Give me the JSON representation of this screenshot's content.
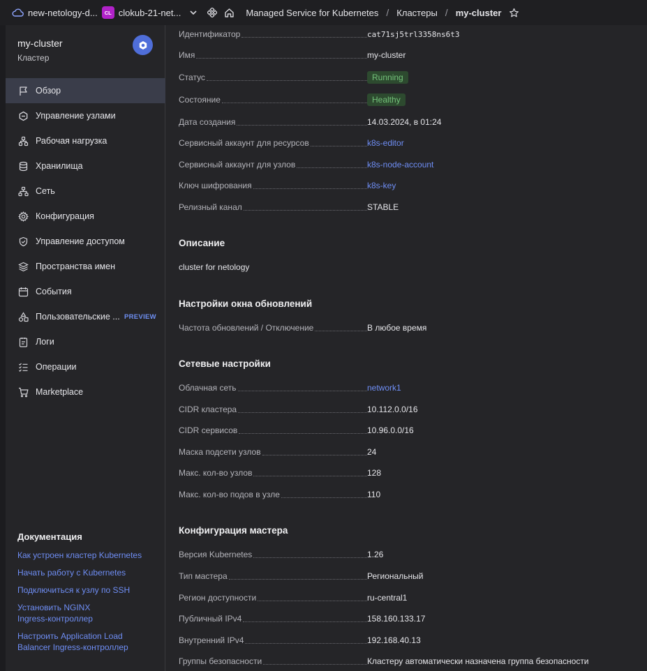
{
  "topbar": {
    "cloud_name": "new-netology-d...",
    "folder_badge": "CL",
    "folder_name": "clokub-21-net...",
    "breadcrumb": [
      "Managed Service for Kubernetes",
      "Кластеры",
      "my-cluster"
    ],
    "separator": "/"
  },
  "cluster": {
    "name": "my-cluster",
    "subtitle": "Кластер"
  },
  "sidebar": {
    "items": [
      {
        "label": "Обзор",
        "icon": "flag-icon",
        "active": true
      },
      {
        "label": "Управление узлами",
        "icon": "nodes-icon"
      },
      {
        "label": "Рабочая нагрузка",
        "icon": "workload-icon"
      },
      {
        "label": "Хранилища",
        "icon": "database-icon"
      },
      {
        "label": "Сеть",
        "icon": "network-icon"
      },
      {
        "label": "Конфигурация",
        "icon": "gear-icon"
      },
      {
        "label": "Управление доступом",
        "icon": "shield-icon"
      },
      {
        "label": "Пространства имен",
        "icon": "namespaces-icon"
      },
      {
        "label": "События",
        "icon": "calendar-icon"
      },
      {
        "label": "Пользовательские ...",
        "icon": "shapes-icon",
        "badge": "PREVIEW"
      },
      {
        "label": "Логи",
        "icon": "logs-icon"
      },
      {
        "label": "Операции",
        "icon": "operations-icon"
      },
      {
        "label": "Marketplace",
        "icon": "cart-icon"
      }
    ]
  },
  "docs": {
    "title": "Документация",
    "links": [
      "Как устроен кластер Kubernetes",
      "Начать работу с Kubernetes",
      "Подключиться к узлу по SSH",
      "Установить NGINX Ingress-контроллер",
      "Настроить Application Load Balancer Ingress-контроллер"
    ]
  },
  "overview": {
    "id_label": "Идентификатор",
    "id_value": "cat71sj5trl3358ns6t3",
    "name_label": "Имя",
    "name_value": "my-cluster",
    "status_label": "Статус",
    "status_value": "Running",
    "health_label": "Состояние",
    "health_value": "Healthy",
    "created_label": "Дата создания",
    "created_value": "14.03.2024, в 01:24",
    "sa_res_label": "Сервисный аккаунт для ресурсов",
    "sa_res_value": "k8s-editor",
    "sa_nodes_label": "Сервисный аккаунт для узлов",
    "sa_nodes_value": "k8s-node-account",
    "key_label": "Ключ шифрования",
    "key_value": "k8s-key",
    "channel_label": "Релизный канал",
    "channel_value": "STABLE"
  },
  "description": {
    "title": "Описание",
    "text": "cluster for netology"
  },
  "maintenance": {
    "title": "Настройки окна обновлений",
    "freq_label": "Частота обновлений / Отключение",
    "freq_value": "В любое время"
  },
  "network": {
    "title": "Сетевые настройки",
    "net_label": "Облачная сеть",
    "net_value": "network1",
    "cidr_cluster_label": "CIDR кластера",
    "cidr_cluster_value": "10.112.0.0/16",
    "cidr_services_label": "CIDR сервисов",
    "cidr_services_value": "10.96.0.0/16",
    "mask_label": "Маска подсети узлов",
    "mask_value": "24",
    "max_nodes_label": "Макс. кол-во узлов",
    "max_nodes_value": "128",
    "max_pods_label": "Макс. кол-во подов в узле",
    "max_pods_value": "110"
  },
  "master": {
    "title": "Конфигурация мастера",
    "version_label": "Версия Kubernetes",
    "version_value": "1.26",
    "type_label": "Тип мастера",
    "type_value": "Региональный",
    "region_label": "Регион доступности",
    "region_value": "ru-central1",
    "public_label": "Публичный IPv4",
    "public_value": "158.160.133.17",
    "internal_label": "Внутренний IPv4",
    "internal_value": "192.168.40.13",
    "sg_label": "Группы безопасности",
    "sg_value": "Кластеру автоматически назначена группа безопасности"
  },
  "colors": {
    "accent": "#4f6ed9",
    "link": "#6f8ef5",
    "ok_bg": "#2d4a2f",
    "ok_text": "#74c27a",
    "folder_badge": "#b122c9"
  }
}
